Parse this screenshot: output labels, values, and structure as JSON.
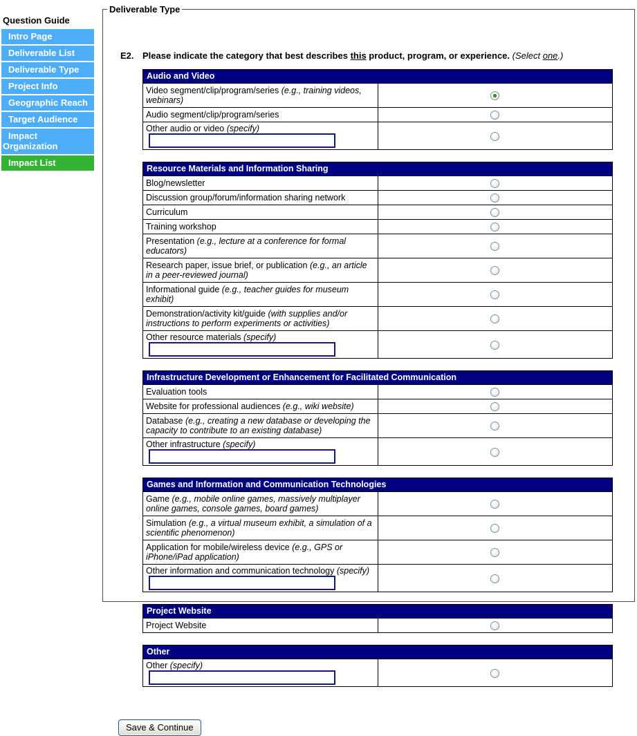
{
  "sidebar": {
    "title": "Question Guide",
    "items": [
      {
        "label": "Intro Page",
        "color": "blue"
      },
      {
        "label": "Deliverable List",
        "color": "blue"
      },
      {
        "label": "Deliverable Type",
        "color": "blue"
      },
      {
        "label": "Project Info",
        "color": "blue"
      },
      {
        "label": "Geographic Reach",
        "color": "blue"
      },
      {
        "label": "Target Audience",
        "color": "blue"
      },
      {
        "label": "Impact Organization",
        "color": "blue"
      },
      {
        "label": "Impact List",
        "color": "green"
      }
    ]
  },
  "main": {
    "legend": "Deliverable Type",
    "question": {
      "number": "E2.",
      "before": "Please indicate the category that best describes ",
      "underlined": "this",
      "after": " product, program, or experience. ",
      "note_pre": "(Select ",
      "note_underlined": "one",
      "note_post": ".)"
    },
    "groups": [
      {
        "header": "Audio and Video",
        "rows": [
          {
            "label": "Video segment/clip/program/series ",
            "example": "(e.g., training videos, webinars)",
            "selected": true
          },
          {
            "label": "Audio segment/clip/program/series",
            "selected": false
          },
          {
            "label": "Other audio or video ",
            "example": "(specify)",
            "has_input": true,
            "input_value": "",
            "selected": false
          }
        ]
      },
      {
        "header": "Resource Materials and Information Sharing",
        "rows": [
          {
            "label": "Blog/newsletter",
            "selected": false
          },
          {
            "label": "Discussion group/forum/information sharing network",
            "selected": false
          },
          {
            "label": "Curriculum",
            "selected": false
          },
          {
            "label": "Training workshop",
            "selected": false
          },
          {
            "label": "Presentation ",
            "example": "(e.g., lecture at a conference for formal educators)",
            "selected": false
          },
          {
            "label": "Research paper, issue brief, or publication ",
            "example": "(e.g., an article in a peer-reviewed journal)",
            "selected": false
          },
          {
            "label": "Informational guide ",
            "example": "(e.g., teacher guides for museum exhibit)",
            "selected": false
          },
          {
            "label": "Demonstration/activity kit/guide ",
            "example": "(with supplies and/or instructions to perform experiments or activities)",
            "selected": false
          },
          {
            "label": "Other resource materials ",
            "example": "(specify)",
            "has_input": true,
            "input_value": "",
            "selected": false
          }
        ]
      },
      {
        "header": "Infrastructure Development or Enhancement for Facilitated Communication",
        "rows": [
          {
            "label": "Evaluation tools",
            "selected": false
          },
          {
            "label": "Website for professional audiences ",
            "example": "(e.g., wiki website)",
            "selected": false
          },
          {
            "label": "Database ",
            "example": "(e.g., creating a new database or developing the capacity to contribute to an existing database)",
            "selected": false
          },
          {
            "label": "Other infrastructure ",
            "example": "(specify)",
            "has_input": true,
            "input_value": "",
            "selected": false
          }
        ]
      },
      {
        "header": "Games and Information and Communication Technologies",
        "rows": [
          {
            "label": "Game ",
            "example": "(e.g., mobile online games, massively multiplayer online games, console games, board games)",
            "selected": false
          },
          {
            "label": "Simulation ",
            "example": "(e.g., a virtual museum exhibit, a simulation of a scientific phenomenon)",
            "selected": false
          },
          {
            "label": "Application for mobile/wireless device ",
            "example": "(e.g., GPS or iPhone/iPad application)",
            "selected": false
          },
          {
            "label": "Other information and communication technology ",
            "example": "(specify)",
            "has_input": true,
            "input_value": "",
            "selected": false
          }
        ]
      },
      {
        "header": "Project Website",
        "rows": [
          {
            "label": "Project Website",
            "selected": false
          }
        ]
      },
      {
        "header": "Other",
        "rows": [
          {
            "label": "Other ",
            "example": "(specify)",
            "has_input": true,
            "input_value": "",
            "selected": false
          }
        ]
      }
    ],
    "save_button": "Save & Continue"
  },
  "colors": {
    "sidebar_blue": "#4daef7",
    "sidebar_green": "#33b333",
    "group_header_navy": "#000080",
    "selected_radio_dot": "#2fa62f"
  },
  "icons": {
    "radio_selected": "radio-selected-icon",
    "radio_unselected": "radio-unselected-icon"
  }
}
